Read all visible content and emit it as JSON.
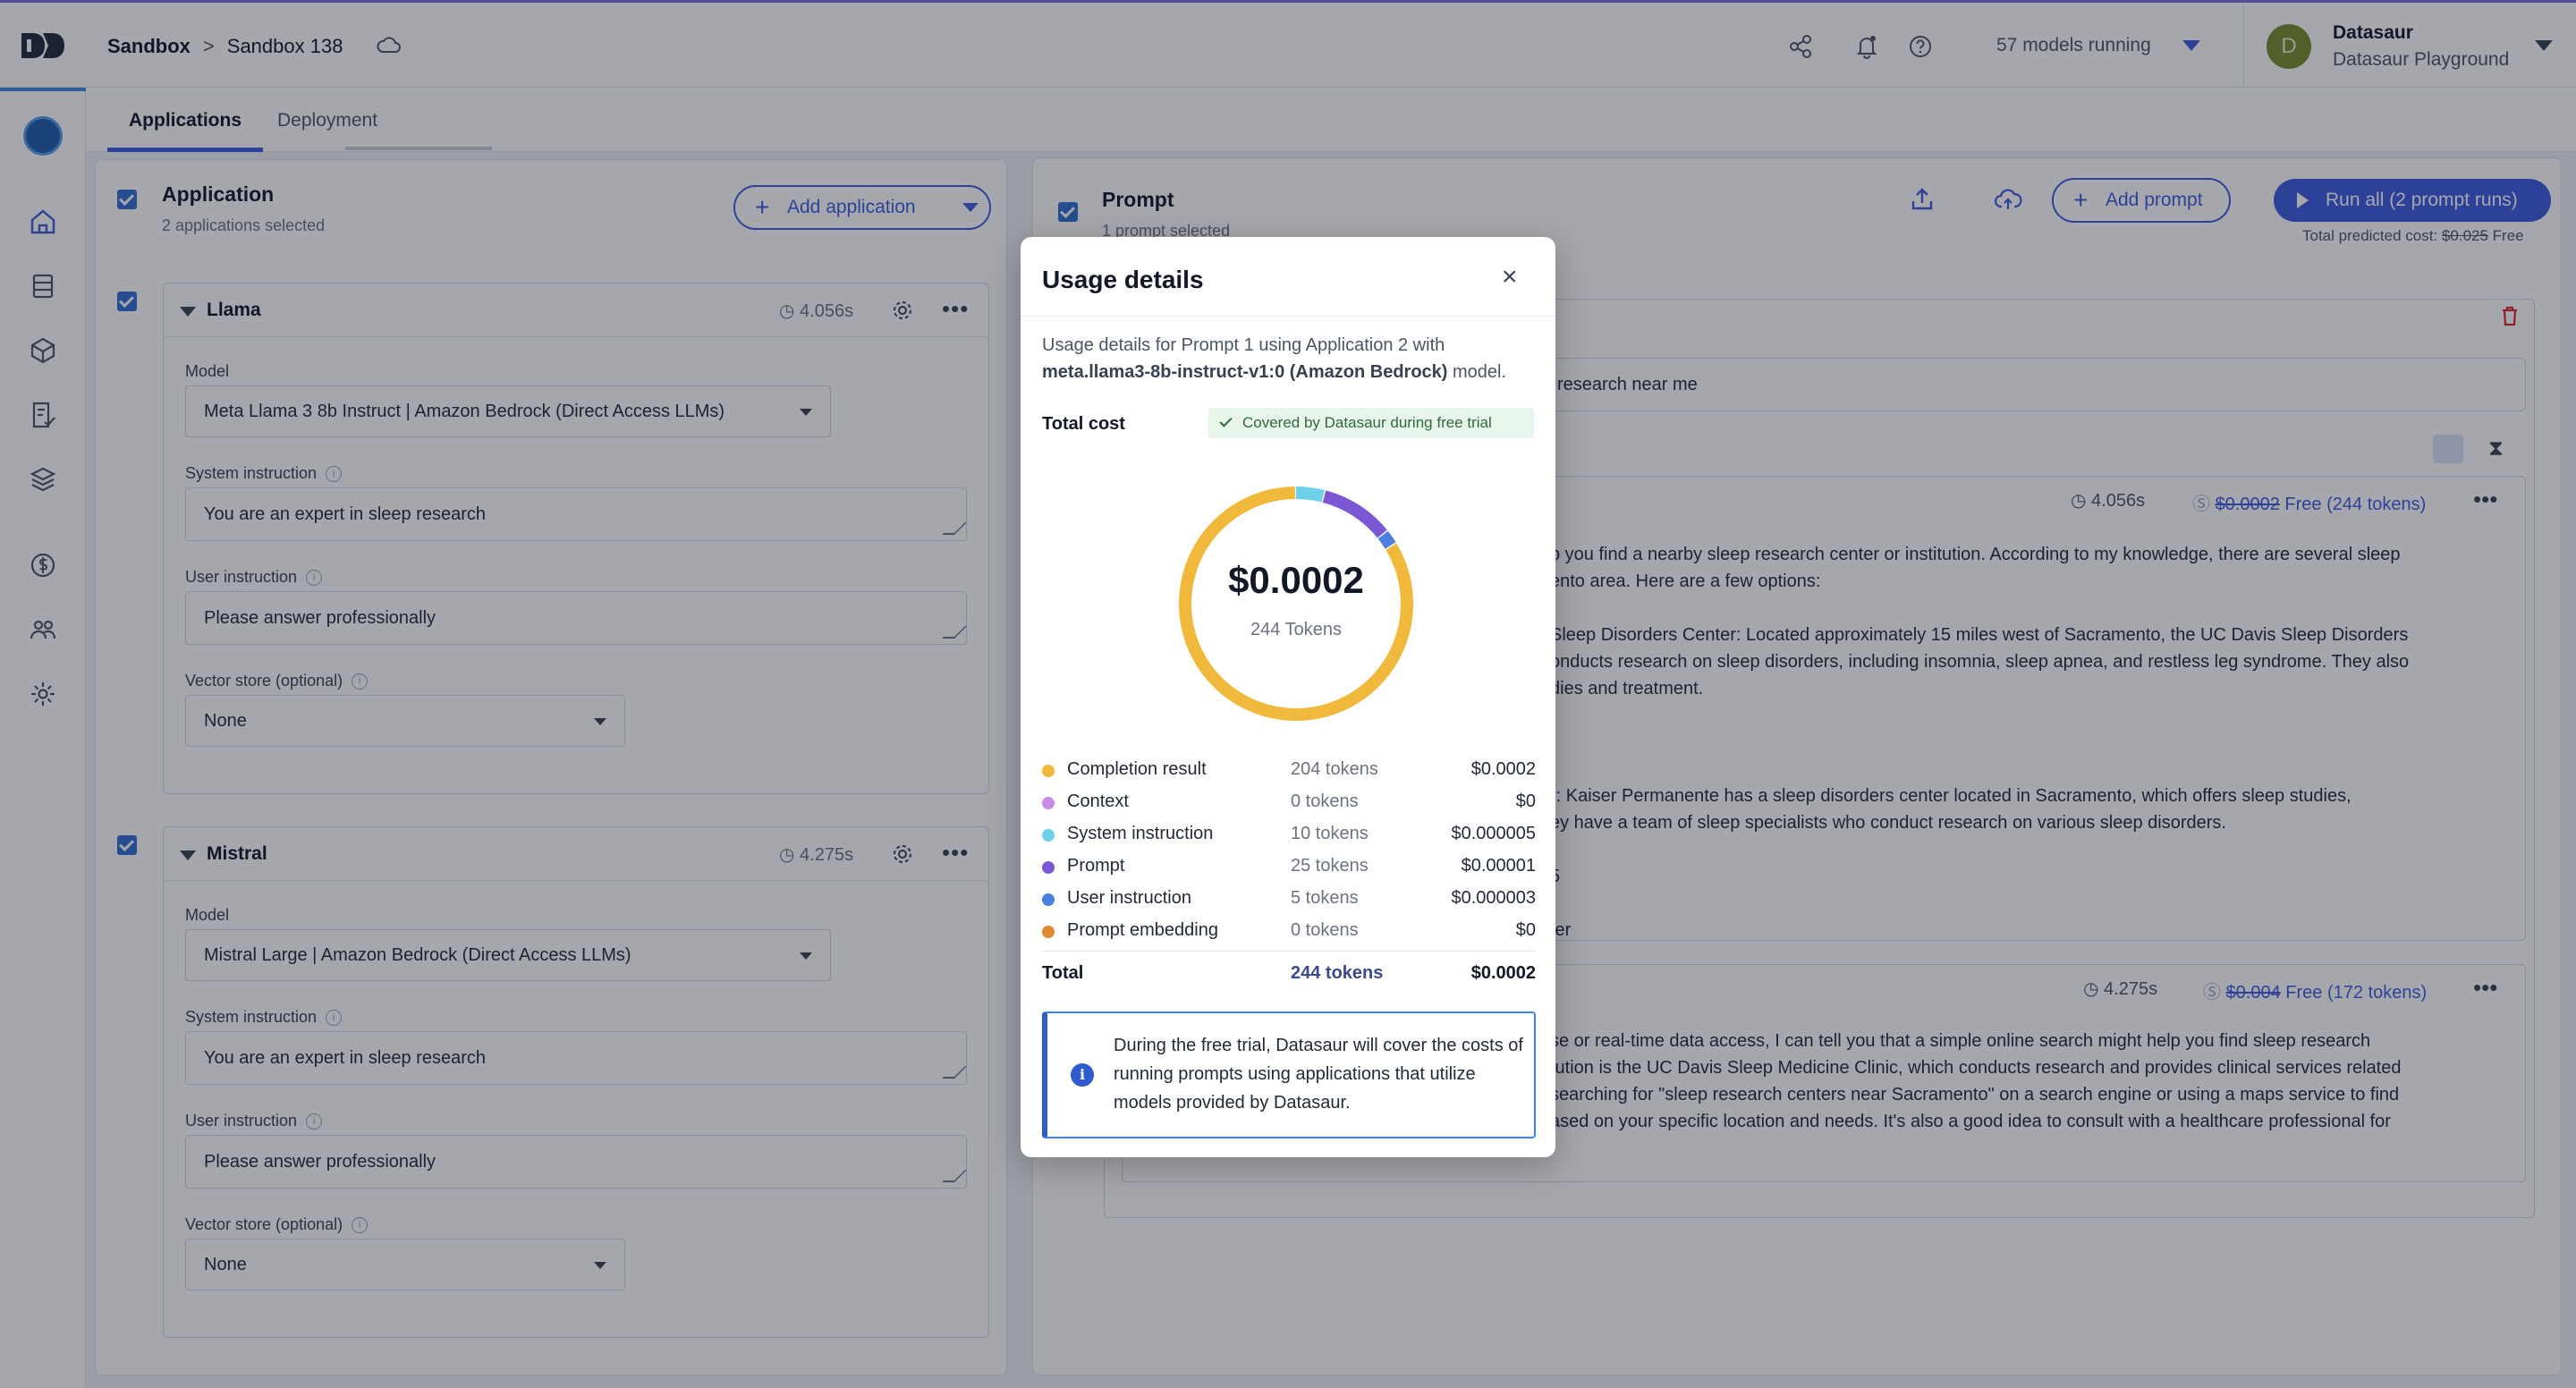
{
  "topbar": {
    "breadcrumb_root": "Sandbox",
    "breadcrumb_sep": ">",
    "breadcrumb_current": "Sandbox 138",
    "models_running": "57 models running",
    "user_name": "Datasaur",
    "user_org": "Datasaur Playground",
    "avatar_initial": "D"
  },
  "tabs": {
    "applications": "Applications",
    "deployment": "Deployment"
  },
  "left": {
    "title": "Application",
    "subtitle": "2 applications selected",
    "add_button": "Add application",
    "apps": [
      {
        "name": "Llama",
        "time": "4.056s",
        "model_label": "Model",
        "model": "Meta Llama 3 8b Instruct | Amazon Bedrock (Direct Access LLMs)",
        "system_label": "System instruction",
        "system": "You are an expert in sleep research",
        "user_label": "User instruction",
        "user": "Please answer professionally",
        "vector_label": "Vector store (optional)",
        "vector": "None"
      },
      {
        "name": "Mistral",
        "time": "4.275s",
        "model_label": "Model",
        "model": "Mistral Large | Amazon Bedrock (Direct Access LLMs)",
        "system_label": "System instruction",
        "system": "You are an expert in sleep research",
        "user_label": "User instruction",
        "user": "Please answer professionally",
        "vector_label": "Vector store (optional)",
        "vector": "None"
      }
    ]
  },
  "right": {
    "title": "Prompt",
    "subtitle": "1 prompt selected",
    "add_prompt": "Add prompt",
    "run_all": "Run all (2 prompt runs)",
    "total_pred_label": "Total predicted cost:",
    "total_pred_old": "$0.025",
    "total_pred_new": "Free",
    "prompt_text_visible": "research near me",
    "responses": [
      {
        "time": "4.056s",
        "cost_old": "$0.0002",
        "cost_new": "Free (244 tokens)",
        "lines": [
          "p you find a nearby sleep research center or institution. According to my knowledge, there are several sleep",
          "ento area. Here are a few options:",
          "",
          "Sleep Disorders Center: Located approximately 15 miles west of Sacramento, the UC Davis Sleep Disorders",
          "onducts research on sleep disorders, including insomnia, sleep apnea, and restless leg syndrome. They also",
          "dies and treatment.",
          "",
          "",
          "",
          "r: Kaiser Permanente has a sleep disorders center located in Sacramento, which offers sleep studies,",
          "ey have a team of sleep specialists who conduct research on various sleep disorders.",
          "",
          "5",
          "",
          "ter"
        ]
      },
      {
        "time": "4.275s",
        "cost_old": "$0.004",
        "cost_new": "Free (172 tokens)",
        "lines": [
          "se or real-time data access, I can tell you that a simple online search might help you find sleep research",
          "tution is the UC Davis Sleep Medicine Clinic, which conducts research and provides clinical services related",
          "searching for \"sleep research centers near Sacramento\" on a search engine or using a maps service to find",
          "ased on your specific location and needs. It's also a good idea to consult with a healthcare professional for"
        ]
      }
    ]
  },
  "modal": {
    "title": "Usage details",
    "desc_prefix": "Usage details for Prompt 1 using Application 2 with",
    "desc_model": "meta.llama3-8b-instruct-v1:0 (Amazon Bedrock)",
    "desc_suffix": "model.",
    "total_cost_label": "Total cost",
    "covered_badge": "Covered by Datasaur during free trial",
    "donut_amount": "$0.0002",
    "donut_tokens": "244 Tokens",
    "breakdown": [
      {
        "name": "Completion result",
        "tokens": "204 tokens",
        "cost": "$0.0002",
        "count": 204,
        "color": "#f0b93b"
      },
      {
        "name": "Context",
        "tokens": "0 tokens",
        "cost": "$0",
        "count": 0,
        "color": "#c98be6"
      },
      {
        "name": "System instruction",
        "tokens": "10 tokens",
        "cost": "$0.000005",
        "count": 10,
        "color": "#6fd0ea"
      },
      {
        "name": "Prompt",
        "tokens": "25 tokens",
        "cost": "$0.00001",
        "count": 25,
        "color": "#7b57d6"
      },
      {
        "name": "User instruction",
        "tokens": "5 tokens",
        "cost": "$0.000003",
        "count": 5,
        "color": "#4a7fe0"
      },
      {
        "name": "Prompt embedding",
        "tokens": "0 tokens",
        "cost": "$0",
        "count": 0,
        "color": "#e08a2e"
      }
    ],
    "total_label": "Total",
    "total_tokens": "244 tokens",
    "total_cost": "$0.0002",
    "info_text": "During the free trial, Datasaur will cover the costs of running prompts using applications that utilize models provided by Datasaur."
  }
}
